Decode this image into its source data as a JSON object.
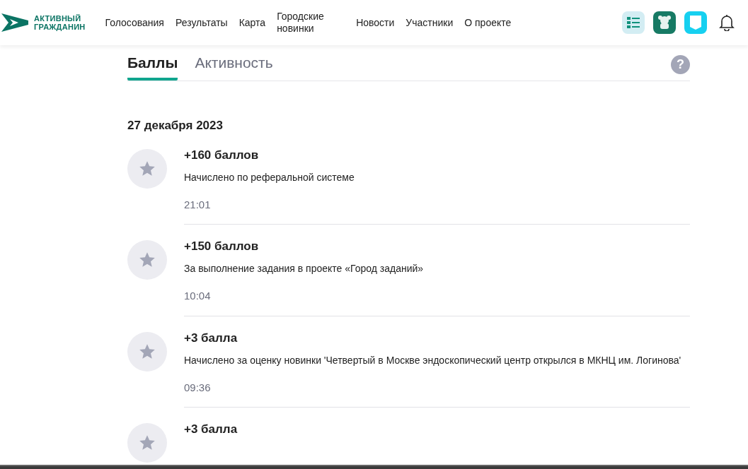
{
  "logo": {
    "line_1": "АКТИВНЫЙ",
    "line_2": "ГРАЖДАНИН"
  },
  "nav": [
    {
      "label": "Голосования"
    },
    {
      "label": "Результаты"
    },
    {
      "label": "Карта"
    },
    {
      "label": "Городские новинки"
    },
    {
      "label": "Новости"
    },
    {
      "label": "Участники"
    },
    {
      "label": "О проекте"
    }
  ],
  "tabs": [
    {
      "label": "Баллы",
      "selected": true
    },
    {
      "label": "Активность",
      "selected": false
    }
  ],
  "help_button": "?",
  "date": "27 декабря 2023",
  "entries": [
    {
      "points": "+160 баллов",
      "description": "Начислено по реферальной системе",
      "time": "21:01"
    },
    {
      "points": "+150 баллов",
      "description": "За выполнение задания в проекте «Город заданий»",
      "time": "10:04"
    },
    {
      "points": "+3 балла",
      "description": "Начислено за оценку новинки 'Четвертый в Москве эндоскопический центр открылся в МКНЦ им. Логинова'",
      "time": "09:36"
    },
    {
      "points": "+3 балла"
    }
  ]
}
